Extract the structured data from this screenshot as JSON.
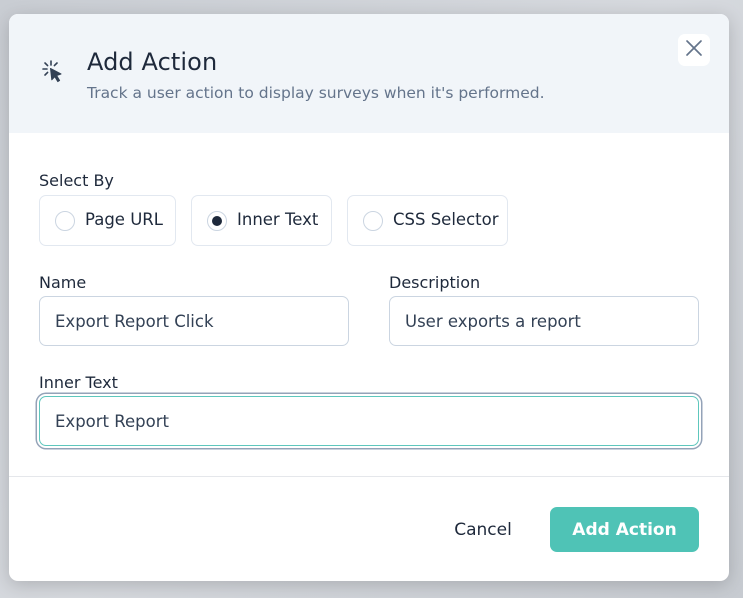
{
  "modal": {
    "title": "Add Action",
    "subtitle": "Track a user action to display surveys when it's performed.",
    "header_icon": "cursor-click-icon",
    "close_icon": "close-icon"
  },
  "select_by": {
    "label": "Select By",
    "options": [
      {
        "label": "Page URL",
        "checked": false
      },
      {
        "label": "Inner Text",
        "checked": true
      },
      {
        "label": "CSS Selector",
        "checked": false
      }
    ]
  },
  "fields": {
    "name": {
      "label": "Name",
      "value": "Export Report Click"
    },
    "description": {
      "label": "Description",
      "value": "User exports a report"
    },
    "inner_text": {
      "label": "Inner Text",
      "value": "Export Report"
    }
  },
  "footer": {
    "cancel_label": "Cancel",
    "submit_label": "Add Action"
  },
  "colors": {
    "accent": "#4fc3b6",
    "header_bg": "#f1f5f9",
    "text": "#1e293b",
    "muted": "#64748b"
  }
}
